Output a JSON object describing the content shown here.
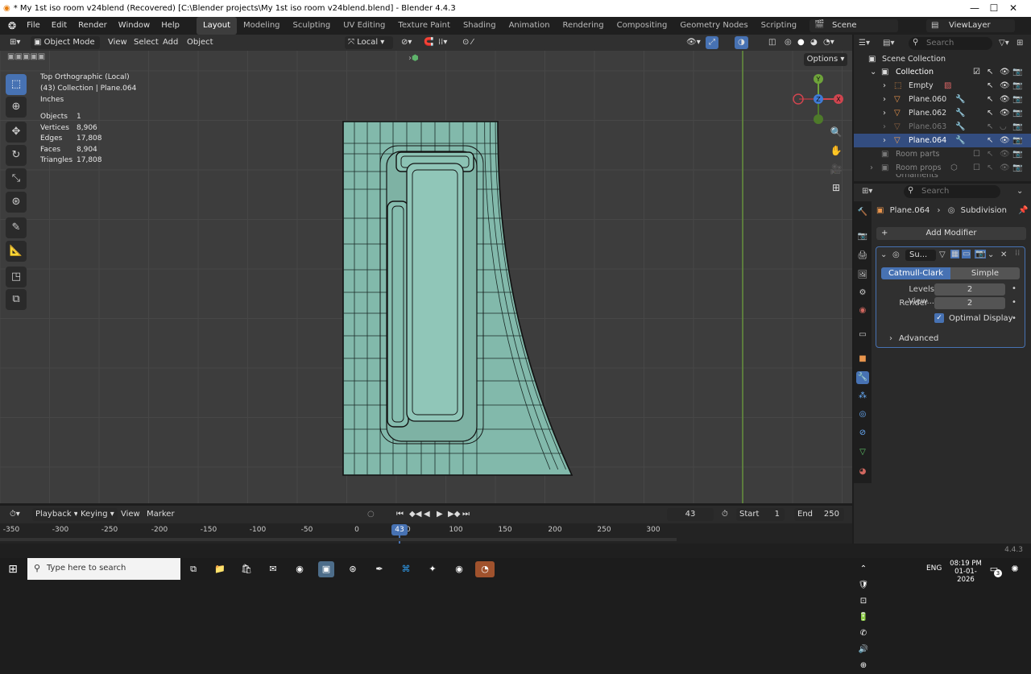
{
  "window": {
    "title": "* My 1st iso room v24blend (Recovered) [C:\\Blender projects\\My 1st iso room v24blend.blend] - Blender 4.4.3",
    "min": "—",
    "max": "☐",
    "close": "✕"
  },
  "menus": [
    "File",
    "Edit",
    "Render",
    "Window",
    "Help"
  ],
  "workspaces": [
    "Layout",
    "Modeling",
    "Sculpting",
    "UV Editing",
    "Texture Paint",
    "Shading",
    "Animation",
    "Rendering",
    "Compositing",
    "Geometry Nodes",
    "Scripting",
    "+"
  ],
  "scene": {
    "label": "Scene",
    "view_layer": "ViewLayer"
  },
  "viewport_header": {
    "mode": "Object Mode",
    "view": "View",
    "select": "Select",
    "add": "Add",
    "object": "Object",
    "orientation": "Local",
    "options": "Options"
  },
  "overlay": {
    "view_name": "Top Orthographic (Local)",
    "collection": "(43) Collection | Plane.064",
    "units": "Inches",
    "stats": [
      {
        "label": "Objects",
        "value": "1"
      },
      {
        "label": "Vertices",
        "value": "8,906"
      },
      {
        "label": "Edges",
        "value": "17,808"
      },
      {
        "label": "Faces",
        "value": "8,904"
      },
      {
        "label": "Triangles",
        "value": "17,808"
      }
    ]
  },
  "gizmo": {
    "y": "Y",
    "z": "Z",
    "x": "X"
  },
  "outliner": {
    "search_placeholder": "Search",
    "root": "Scene Collection",
    "items": [
      {
        "name": "Collection"
      },
      {
        "name": "Empty"
      },
      {
        "name": "Plane.060"
      },
      {
        "name": "Plane.062"
      },
      {
        "name": "Plane.063"
      },
      {
        "name": "Plane.064"
      },
      {
        "name": "Room parts"
      },
      {
        "name": "Room props"
      },
      {
        "name": "Ornaments"
      }
    ]
  },
  "properties": {
    "search_placeholder": "Search",
    "object": "Plane.064",
    "modifier_crumb": "Subdivision",
    "add_modifier": "Add Modifier",
    "modifier_name": "Su...",
    "catmull": "Catmull-Clark",
    "simple": "Simple",
    "levels_label": "Levels View...",
    "levels_value": "2",
    "render_label": "Render",
    "render_value": "2",
    "optimal": "Optimal Display",
    "advanced": "Advanced"
  },
  "timeline": {
    "playback": "Playback",
    "keying": "Keying",
    "view": "View",
    "marker": "Marker",
    "current_frame": "43",
    "start_label": "Start",
    "start": "1",
    "end_label": "End",
    "end": "250",
    "ticks": [
      "-350",
      "-300",
      "-250",
      "-200",
      "-150",
      "-100",
      "-50",
      "0",
      "50",
      "100",
      "150",
      "200",
      "250",
      "300"
    ],
    "playhead": "43"
  },
  "status": {
    "version": "4.4.3"
  },
  "taskbar": {
    "search_placeholder": "Type here to search",
    "lang": "ENG",
    "time": "08:19 PM",
    "date": "01-01-2026",
    "badge": "3"
  }
}
